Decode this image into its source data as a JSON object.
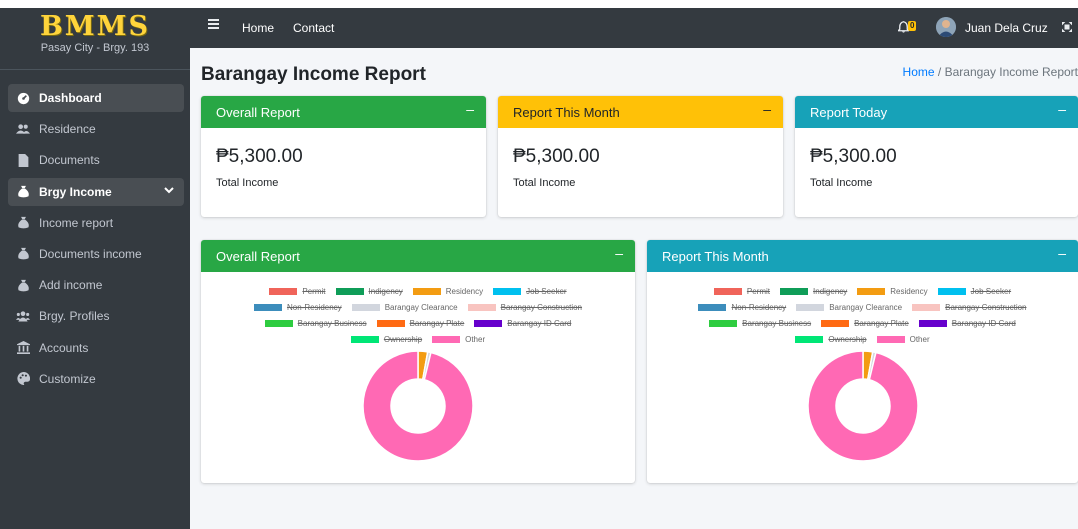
{
  "sidebar": {
    "brand_logo": "BMMS",
    "brand_sub": "Pasay City - Brgy. 193",
    "items": [
      {
        "label": "Dashboard",
        "icon": "tachometer-icon"
      },
      {
        "label": "Residence",
        "icon": "users-icon"
      },
      {
        "label": "Documents",
        "icon": "file-icon"
      },
      {
        "label": "Brgy Income",
        "icon": "money-bag-icon"
      },
      {
        "label": "Income report",
        "icon": "money-bag-icon"
      },
      {
        "label": "Documents income",
        "icon": "money-bag-icon"
      },
      {
        "label": "Add income",
        "icon": "money-bag-icon"
      },
      {
        "label": "Brgy. Profiles",
        "icon": "user-group-icon"
      },
      {
        "label": "Accounts",
        "icon": "building-icon"
      },
      {
        "label": "Customize",
        "icon": "palette-icon"
      }
    ]
  },
  "topbar": {
    "home": "Home",
    "contact": "Contact",
    "notification_count": "0",
    "user_name": "Juan Dela Cruz"
  },
  "content": {
    "page_title": "Barangay Income Report",
    "breadcrumb_home": "Home",
    "breadcrumb_sep": "/",
    "breadcrumb_current": "Barangay Income Report"
  },
  "summary_cards": [
    {
      "title": "Overall Report",
      "amount": "₱5,300.00",
      "label": "Total Income",
      "color": "#28a745"
    },
    {
      "title": "Report This Month",
      "amount": "₱5,300.00",
      "label": "Total Income",
      "color": "#ffc107"
    },
    {
      "title": "Report Today",
      "amount": "₱5,300.00",
      "label": "Total Income",
      "color": "#17a2b8"
    }
  ],
  "chart_cards": [
    {
      "title": "Overall Report",
      "color": "#28a745"
    },
    {
      "title": "Report This Month",
      "color": "#17a2b8"
    }
  ],
  "chart_data": [
    {
      "type": "pie",
      "categories": [
        "Permit",
        "Indigency",
        "Residency",
        "Job Seeker",
        "Non-Residency",
        "Barangay Clearance",
        "Barangay Construction",
        "Barangay Business",
        "Barangay Plate",
        "Barangay ID Card",
        "Ownership",
        "Other"
      ],
      "hidden": [
        true,
        true,
        false,
        true,
        true,
        false,
        true,
        true,
        true,
        true,
        true,
        false
      ],
      "colors": [
        "#f0645a",
        "#0f9d58",
        "#f39c12",
        "#00c0ef",
        "#3c8dbc",
        "#d2d6de",
        "#f8c4c0",
        "#2ecc40",
        "#ff6a13",
        "#6600cc",
        "#00e676",
        "#ff69b4"
      ],
      "values": [
        0,
        0,
        150,
        0,
        0,
        50,
        0,
        0,
        0,
        0,
        0,
        5100
      ]
    },
    {
      "type": "pie",
      "categories": [
        "Permit",
        "Indigency",
        "Residency",
        "Job Seeker",
        "Non-Residency",
        "Barangay Clearance",
        "Barangay Construction",
        "Barangay Business",
        "Barangay Plate",
        "Barangay ID Card",
        "Ownership",
        "Other"
      ],
      "hidden": [
        true,
        true,
        false,
        true,
        true,
        false,
        true,
        true,
        true,
        true,
        true,
        false
      ],
      "colors": [
        "#f0645a",
        "#0f9d58",
        "#f39c12",
        "#00c0ef",
        "#3c8dbc",
        "#d2d6de",
        "#f8c4c0",
        "#2ecc40",
        "#ff6a13",
        "#6600cc",
        "#00e676",
        "#ff69b4"
      ],
      "values": [
        0,
        0,
        150,
        0,
        0,
        50,
        0,
        0,
        0,
        0,
        0,
        5100
      ]
    }
  ]
}
